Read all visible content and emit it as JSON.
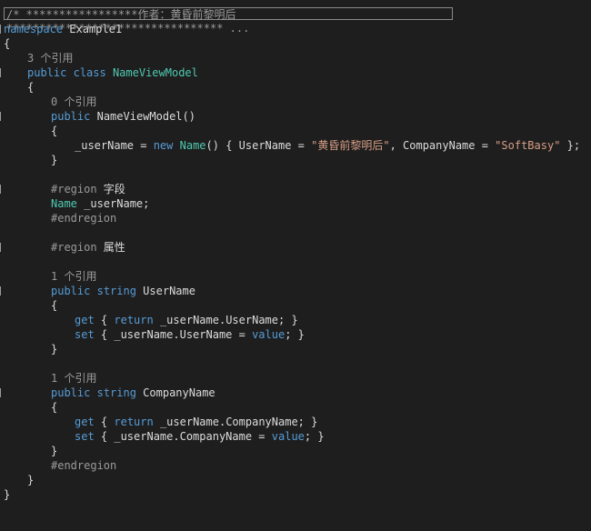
{
  "editor": {
    "collapsed_comment": "/* *****************作者：黄昏前黎明后********************************* ...",
    "lines": {
      "l1_kw": "namespace",
      "l1_rest": " Example1",
      "open_brace": "{",
      "close_brace": "}",
      "ref3": "3 个引用",
      "ref0": "0 个引用",
      "ref1": "1 个引用",
      "public": "public",
      "class": "class",
      "new": "new",
      "string": "string",
      "get": "get",
      "set": "set",
      "return": "return",
      "value": "value",
      "class_name": "NameViewModel",
      "ctor_name": "NameViewModel",
      "ctor_parens": "()",
      "assign_start": "_userName = ",
      "type_name": "Name",
      "init_mid1": "() { UserName = ",
      "str_user": "\"黄昏前黎明后\"",
      "init_mid2": ", CompanyName = ",
      "str_company": "\"SoftBasy\"",
      "init_end": " };",
      "region": "#region",
      "region_fields": " 字段",
      "region_props": " 属性",
      "endregion": "#endregion",
      "field_type": "Name",
      "field_rest": " _userName;",
      "prop_username": " UserName",
      "prop_company": " CompanyName",
      "get_user_a": " { ",
      "get_user_b": " _userName.UserName; }",
      "set_user": " { _userName.UserName = ",
      "set_end": "; }",
      "get_company_b": " _userName.CompanyName; }",
      "set_company": " { _userName.CompanyName = "
    }
  }
}
